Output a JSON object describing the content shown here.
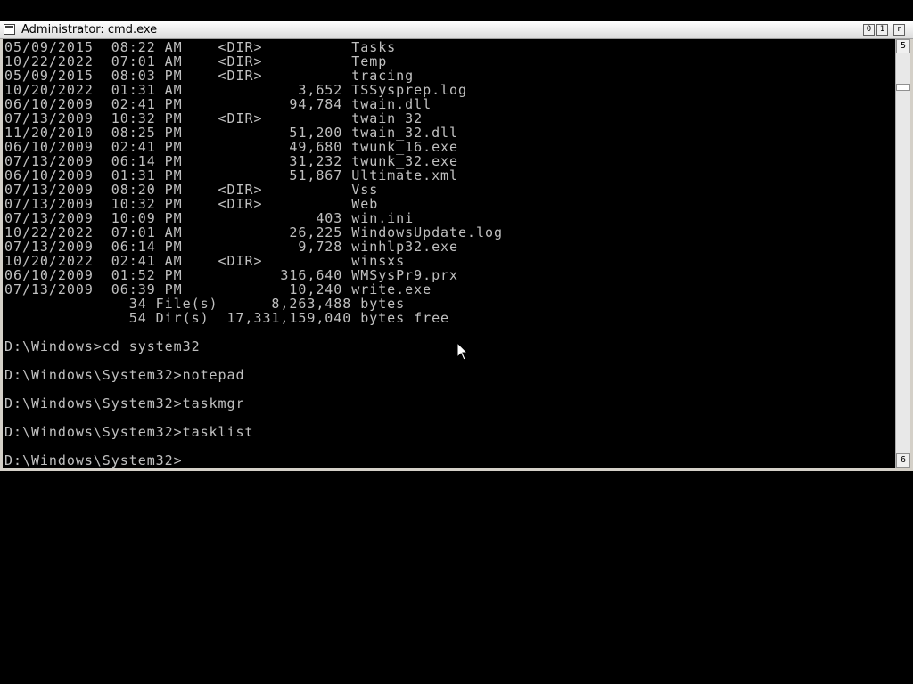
{
  "window": {
    "title": "Administrator: cmd.exe",
    "min_glyph": "0",
    "max_glyph": "1",
    "close_glyph": "r"
  },
  "scrollbar": {
    "up_glyph": "5",
    "down_glyph": "6"
  },
  "console": {
    "lines": [
      "05/09/2015  08:22 AM    <DIR>          Tasks",
      "10/22/2022  07:01 AM    <DIR>          Temp",
      "05/09/2015  08:03 PM    <DIR>          tracing",
      "10/20/2022  01:31 AM             3,652 TSSysprep.log",
      "06/10/2009  02:41 PM            94,784 twain.dll",
      "07/13/2009  10:32 PM    <DIR>          twain_32",
      "11/20/2010  08:25 PM            51,200 twain_32.dll",
      "06/10/2009  02:41 PM            49,680 twunk_16.exe",
      "07/13/2009  06:14 PM            31,232 twunk_32.exe",
      "06/10/2009  01:31 PM            51,867 Ultimate.xml",
      "07/13/2009  08:20 PM    <DIR>          Vss",
      "07/13/2009  10:32 PM    <DIR>          Web",
      "07/13/2009  10:09 PM               403 win.ini",
      "10/22/2022  07:01 AM            26,225 WindowsUpdate.log",
      "07/13/2009  06:14 PM             9,728 winhlp32.exe",
      "10/20/2022  02:41 AM    <DIR>          winsxs",
      "06/10/2009  01:52 PM           316,640 WMSysPr9.prx",
      "07/13/2009  06:39 PM            10,240 write.exe",
      "              34 File(s)      8,263,488 bytes",
      "              54 Dir(s)  17,331,159,040 bytes free",
      "",
      "D:\\Windows>cd system32",
      "",
      "D:\\Windows\\System32>notepad",
      "",
      "D:\\Windows\\System32>taskmgr",
      "",
      "D:\\Windows\\System32>tasklist",
      "",
      "D:\\Windows\\System32>"
    ]
  },
  "colors": {
    "console_bg": "#000000",
    "console_text": "#c0c0c0",
    "titlebar": "#ffffff",
    "desktop": "#000000"
  },
  "icons": {
    "window_icon": "console-window-icon",
    "pointer": "mouse-pointer-icon"
  }
}
